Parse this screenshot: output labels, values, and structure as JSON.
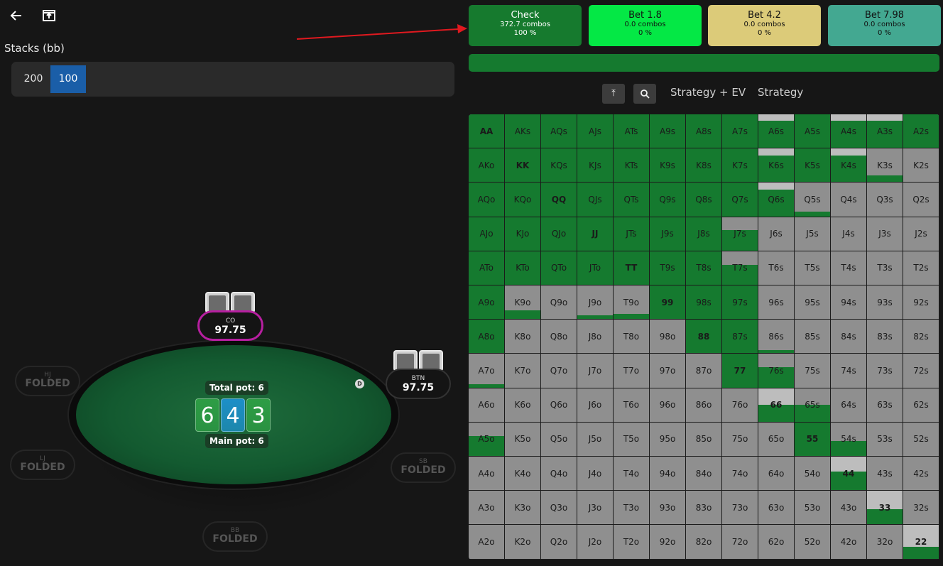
{
  "stacks": {
    "label": "Stacks (bb)",
    "options": [
      "200",
      "100"
    ],
    "active_index": 1
  },
  "table": {
    "total_pot": "Total pot: 6",
    "main_pot": "Main pot: 6",
    "board": [
      "6",
      "4",
      "3"
    ],
    "board_colors": [
      "#2e9d45",
      "#1d8fc8",
      "#2e9d45"
    ],
    "dealer_button": "D",
    "seats": {
      "co": {
        "name": "CO",
        "stack": "97.75"
      },
      "btn": {
        "name": "BTN",
        "stack": "97.75"
      },
      "hj": {
        "name": "HJ",
        "status": "FOLDED"
      },
      "lj": {
        "name": "LJ",
        "status": "FOLDED"
      },
      "sb": {
        "name": "SB",
        "status": "FOLDED"
      },
      "bb": {
        "name": "BB",
        "status": "FOLDED"
      }
    }
  },
  "actions": [
    {
      "label": "Check",
      "combos": "372.7 combos",
      "pct": "100 %",
      "color": "#167a2e"
    },
    {
      "label": "Bet 1.8",
      "combos": "0.0 combos",
      "pct": "0 %",
      "color": "#04e845"
    },
    {
      "label": "Bet 4.2",
      "combos": "0.0 combos",
      "pct": "0 %",
      "color": "#dccb79"
    },
    {
      "label": "Bet 7.98",
      "combos": "0.0 combos",
      "pct": "0 %",
      "color": "#43a891"
    }
  ],
  "strategy_bar_color": "#157a2f",
  "toolbar": {
    "pin_icon": "⤒",
    "zoom_icon": "🔍",
    "tab1": "Strategy + EV",
    "tab2": "Strategy"
  },
  "colors": {
    "check": "#157a2f",
    "cell_gray": "#8f8f8f",
    "highlight_ring": "#b71fa0"
  },
  "matrix": {
    "rows": [
      [
        "AA",
        "AKs",
        "AQs",
        "AJs",
        "ATs",
        "A9s",
        "A8s",
        "A7s",
        "A6s",
        "A5s",
        "A4s",
        "A3s",
        "A2s"
      ],
      [
        "AKo",
        "KK",
        "KQs",
        "KJs",
        "KTs",
        "K9s",
        "K8s",
        "K7s",
        "K6s",
        "K5s",
        "K4s",
        "K3s",
        "K2s"
      ],
      [
        "AQo",
        "KQo",
        "QQ",
        "QJs",
        "QTs",
        "Q9s",
        "Q8s",
        "Q7s",
        "Q6s",
        "Q5s",
        "Q4s",
        "Q3s",
        "Q2s"
      ],
      [
        "AJo",
        "KJo",
        "QJo",
        "JJ",
        "JTs",
        "J9s",
        "J8s",
        "J7s",
        "J6s",
        "J5s",
        "J4s",
        "J3s",
        "J2s"
      ],
      [
        "ATo",
        "KTo",
        "QTo",
        "JTo",
        "TT",
        "T9s",
        "T8s",
        "T7s",
        "T6s",
        "T5s",
        "T4s",
        "T3s",
        "T2s"
      ],
      [
        "A9o",
        "K9o",
        "Q9o",
        "J9o",
        "T9o",
        "99",
        "98s",
        "97s",
        "96s",
        "95s",
        "94s",
        "93s",
        "92s"
      ],
      [
        "A8o",
        "K8o",
        "Q8o",
        "J8o",
        "T8o",
        "98o",
        "88",
        "87s",
        "86s",
        "85s",
        "84s",
        "83s",
        "82s"
      ],
      [
        "A7o",
        "K7o",
        "Q7o",
        "J7o",
        "T7o",
        "97o",
        "87o",
        "77",
        "76s",
        "75s",
        "74s",
        "73s",
        "72s"
      ],
      [
        "A6o",
        "K6o",
        "Q6o",
        "J6o",
        "T6o",
        "96o",
        "86o",
        "76o",
        "66",
        "65s",
        "64s",
        "63s",
        "62s"
      ],
      [
        "A5o",
        "K5o",
        "Q5o",
        "J5o",
        "T5o",
        "95o",
        "85o",
        "75o",
        "65o",
        "55",
        "54s",
        "53s",
        "52s"
      ],
      [
        "A4o",
        "K4o",
        "Q4o",
        "J4o",
        "T4o",
        "94o",
        "84o",
        "74o",
        "64o",
        "54o",
        "44",
        "43s",
        "42s"
      ],
      [
        "A3o",
        "K3o",
        "Q3o",
        "J3o",
        "T3o",
        "93o",
        "83o",
        "73o",
        "63o",
        "53o",
        "43o",
        "33",
        "32s"
      ],
      [
        "A2o",
        "K2o",
        "Q2o",
        "J2o",
        "T2o",
        "92o",
        "82o",
        "72o",
        "62o",
        "52o",
        "42o",
        "32o",
        "22"
      ]
    ],
    "check_freq": [
      [
        1,
        1,
        1,
        1,
        1,
        1,
        1,
        1,
        1,
        1,
        1,
        1,
        1
      ],
      [
        1,
        1,
        1,
        1,
        1,
        1,
        1,
        1,
        1,
        1,
        1,
        0.2,
        0
      ],
      [
        1,
        1,
        1,
        1,
        1,
        1,
        1,
        1,
        1,
        0.15,
        0,
        0,
        0
      ],
      [
        1,
        1,
        1,
        1,
        1,
        1,
        1,
        0.6,
        0,
        0,
        0,
        0,
        0
      ],
      [
        1,
        1,
        1,
        1,
        1,
        1,
        1,
        0.6,
        0,
        0,
        0,
        0,
        0
      ],
      [
        1,
        0.25,
        0,
        0.1,
        0.15,
        1,
        1,
        1,
        0,
        0,
        0,
        0,
        0
      ],
      [
        1,
        0,
        0,
        0,
        0,
        0,
        1,
        1,
        0.1,
        0,
        0,
        0,
        0
      ],
      [
        0.1,
        0,
        0,
        0,
        0,
        0,
        0,
        1,
        0.6,
        0,
        0,
        0,
        0
      ],
      [
        0,
        0,
        0,
        0,
        0,
        0,
        0,
        0,
        0.5,
        0.5,
        0,
        0,
        0
      ],
      [
        0.6,
        0,
        0,
        0,
        0,
        0,
        0,
        0,
        0,
        1,
        0.45,
        0,
        0
      ],
      [
        0,
        0,
        0,
        0,
        0,
        0,
        0,
        0,
        0,
        0,
        0.55,
        0,
        0
      ],
      [
        0,
        0,
        0,
        0,
        0,
        0,
        0,
        0,
        0,
        0,
        0,
        0.45,
        0
      ],
      [
        0,
        0,
        0,
        0,
        0,
        0,
        0,
        0,
        0,
        0,
        0,
        0,
        0.35
      ]
    ],
    "light_top": [
      [
        0,
        0,
        0,
        0,
        0,
        0,
        0,
        0,
        0.2,
        0,
        0.2,
        0.2,
        0
      ],
      [
        0,
        0,
        0,
        0,
        0,
        0,
        0,
        0,
        0.2,
        0,
        0.2,
        0,
        0
      ],
      [
        0,
        0,
        0,
        0,
        0,
        0,
        0,
        0,
        0.2,
        0,
        0,
        0,
        0
      ],
      [
        0,
        0,
        0,
        0,
        0,
        0,
        0,
        0,
        0,
        0,
        0,
        0,
        0
      ],
      [
        0,
        0,
        0,
        0,
        0,
        0,
        0,
        0,
        0,
        0,
        0,
        0,
        0
      ],
      [
        0,
        0,
        0,
        0,
        0,
        0,
        0,
        0,
        0,
        0,
        0,
        0,
        0
      ],
      [
        0,
        0,
        0,
        0,
        0,
        0,
        0,
        0,
        0,
        0,
        0,
        0,
        0
      ],
      [
        0,
        0,
        0,
        0,
        0,
        0,
        0,
        0,
        0,
        0,
        0,
        0,
        0
      ],
      [
        0,
        0,
        0,
        0,
        0,
        0,
        0,
        0,
        0.5,
        0,
        0,
        0,
        0
      ],
      [
        0,
        0,
        0,
        0,
        0,
        0,
        0,
        0,
        0,
        0,
        0,
        0,
        0
      ],
      [
        0,
        0,
        0,
        0,
        0,
        0,
        0,
        0,
        0,
        0,
        0.45,
        0,
        0
      ],
      [
        0,
        0,
        0,
        0,
        0,
        0,
        0,
        0,
        0,
        0,
        0,
        0.55,
        0
      ],
      [
        0,
        0,
        0,
        0,
        0,
        0,
        0,
        0,
        0,
        0,
        0,
        0,
        0.65
      ]
    ]
  }
}
